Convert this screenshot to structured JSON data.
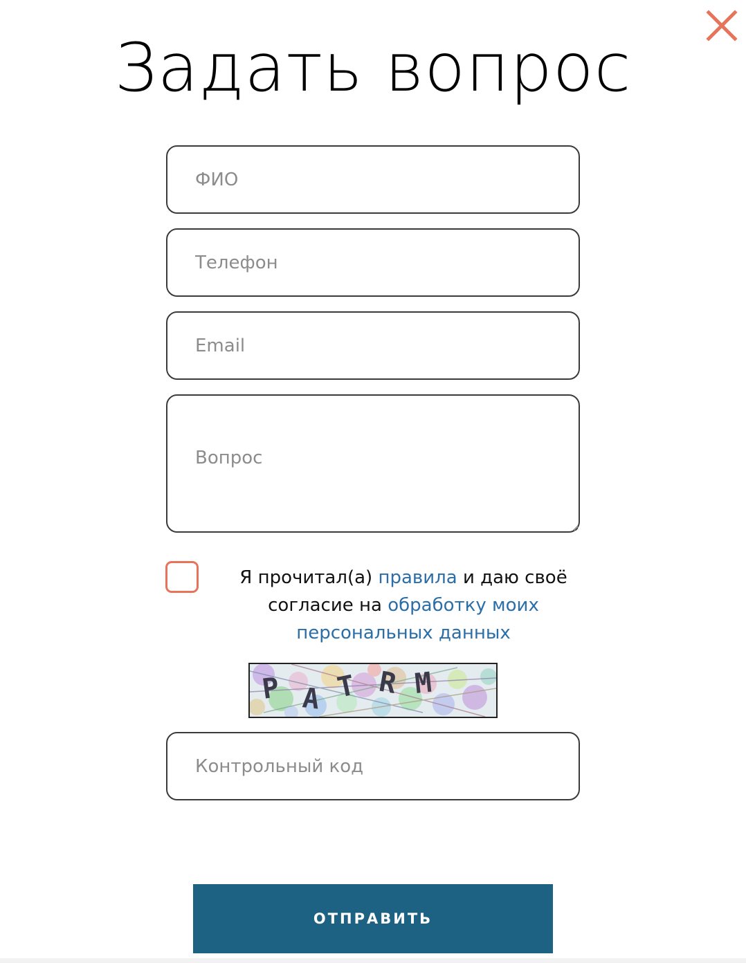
{
  "dialog": {
    "title": "Задать вопрос",
    "close_icon": "close-icon",
    "accent_color": "#e8735b",
    "link_color": "#2b6ea8",
    "button_color": "#1d6283"
  },
  "form": {
    "fio_placeholder": "ФИО",
    "phone_placeholder": "Телефон",
    "email_placeholder": "Email",
    "question_placeholder": "Вопрос",
    "consent": {
      "checked": false,
      "text_1": "Я прочитал(а) ",
      "link_rules": "правила",
      "text_2": " и даю своё согласие на ",
      "link_processing": "обработку моих персональных данных"
    },
    "captcha_text": "PATRM",
    "code_placeholder": "Контрольный код",
    "submit_label": "ОТПРАВИТЬ"
  }
}
